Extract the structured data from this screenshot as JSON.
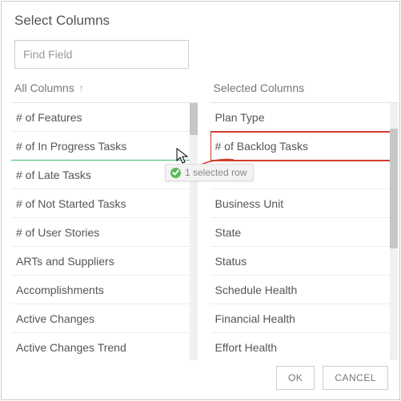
{
  "dialog": {
    "title": "Select Columns",
    "search_placeholder": "Find Field"
  },
  "left": {
    "header": "All Columns",
    "items": [
      "# of Features",
      "# of In Progress Tasks",
      "# of Late Tasks",
      "# of Not Started Tasks",
      "# of User Stories",
      "ARTs and Suppliers",
      "Accomplishments",
      "Active Changes",
      "Active Changes Trend"
    ]
  },
  "right": {
    "header": "Selected Columns",
    "items": [
      "Plan Type",
      "# of Backlog Tasks",
      "",
      "Business Unit",
      "State",
      "Status",
      "Schedule Health",
      "Financial Health",
      "Effort Health"
    ]
  },
  "tooltip": "1 selected row",
  "buttons": {
    "ok": "OK",
    "cancel": "CANCEL"
  }
}
